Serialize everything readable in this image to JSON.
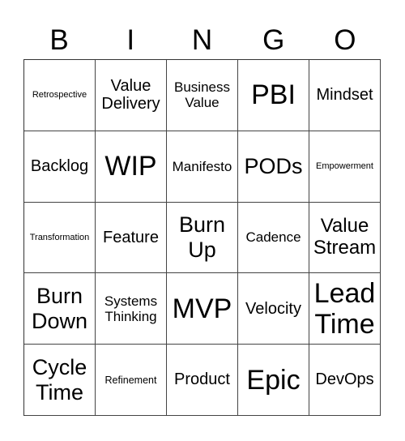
{
  "header": [
    "B",
    "I",
    "N",
    "G",
    "O"
  ],
  "cells": [
    {
      "text": "Retrospective",
      "size": "s-xs"
    },
    {
      "text": "Value Delivery",
      "size": "s-l"
    },
    {
      "text": "Business Value",
      "size": "s-m"
    },
    {
      "text": "PBI",
      "size": "s-h"
    },
    {
      "text": "Mindset",
      "size": "s-l"
    },
    {
      "text": "Backlog",
      "size": "s-l"
    },
    {
      "text": "WIP",
      "size": "s-h"
    },
    {
      "text": "Manifesto",
      "size": "s-m"
    },
    {
      "text": "PODs",
      "size": "s-xxl"
    },
    {
      "text": "Empowerment",
      "size": "s-xs"
    },
    {
      "text": "Transformation",
      "size": "s-xs"
    },
    {
      "text": "Feature",
      "size": "s-l"
    },
    {
      "text": "Burn Up",
      "size": "s-xxl"
    },
    {
      "text": "Cadence",
      "size": "s-m"
    },
    {
      "text": "Value Stream",
      "size": "s-xl"
    },
    {
      "text": "Burn Down",
      "size": "s-xxl"
    },
    {
      "text": "Systems Thinking",
      "size": "s-m"
    },
    {
      "text": "MVP",
      "size": "s-h"
    },
    {
      "text": "Velocity",
      "size": "s-l"
    },
    {
      "text": "Lead Time",
      "size": "s-h"
    },
    {
      "text": "Cycle Time",
      "size": "s-xxl"
    },
    {
      "text": "Refinement",
      "size": "s-s"
    },
    {
      "text": "Product",
      "size": "s-l"
    },
    {
      "text": "Epic",
      "size": "s-h"
    },
    {
      "text": "DevOps",
      "size": "s-l"
    }
  ]
}
